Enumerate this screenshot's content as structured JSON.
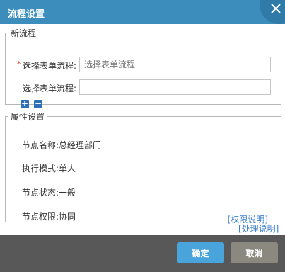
{
  "dialog": {
    "title": "流程设置"
  },
  "new_flow": {
    "legend": "新流程",
    "required_mark": "*",
    "field1_label": "选择表单流程:",
    "field1_placeholder": "选择表单流程",
    "field2_label": "选择表单流程:",
    "field2_value": "",
    "add_symbol": "+",
    "remove_symbol": "−"
  },
  "attributes": {
    "legend": "属性设置",
    "node_name": "节点名称:总经理部门",
    "exec_mode": "执行模式:单人",
    "node_state": "节点状态:一般",
    "node_permission": "节点权限:协同",
    "permission_link": "[权限说明]"
  },
  "process_link": "[处理说明]",
  "footer": {
    "ok_label": "确定",
    "cancel_label": "取消"
  },
  "colors": {
    "titlebar": "#3c8dbc",
    "ok": "#4aa4dc",
    "cancel": "#8b8880",
    "footer": "#585858",
    "link": "#3c7fc8"
  }
}
